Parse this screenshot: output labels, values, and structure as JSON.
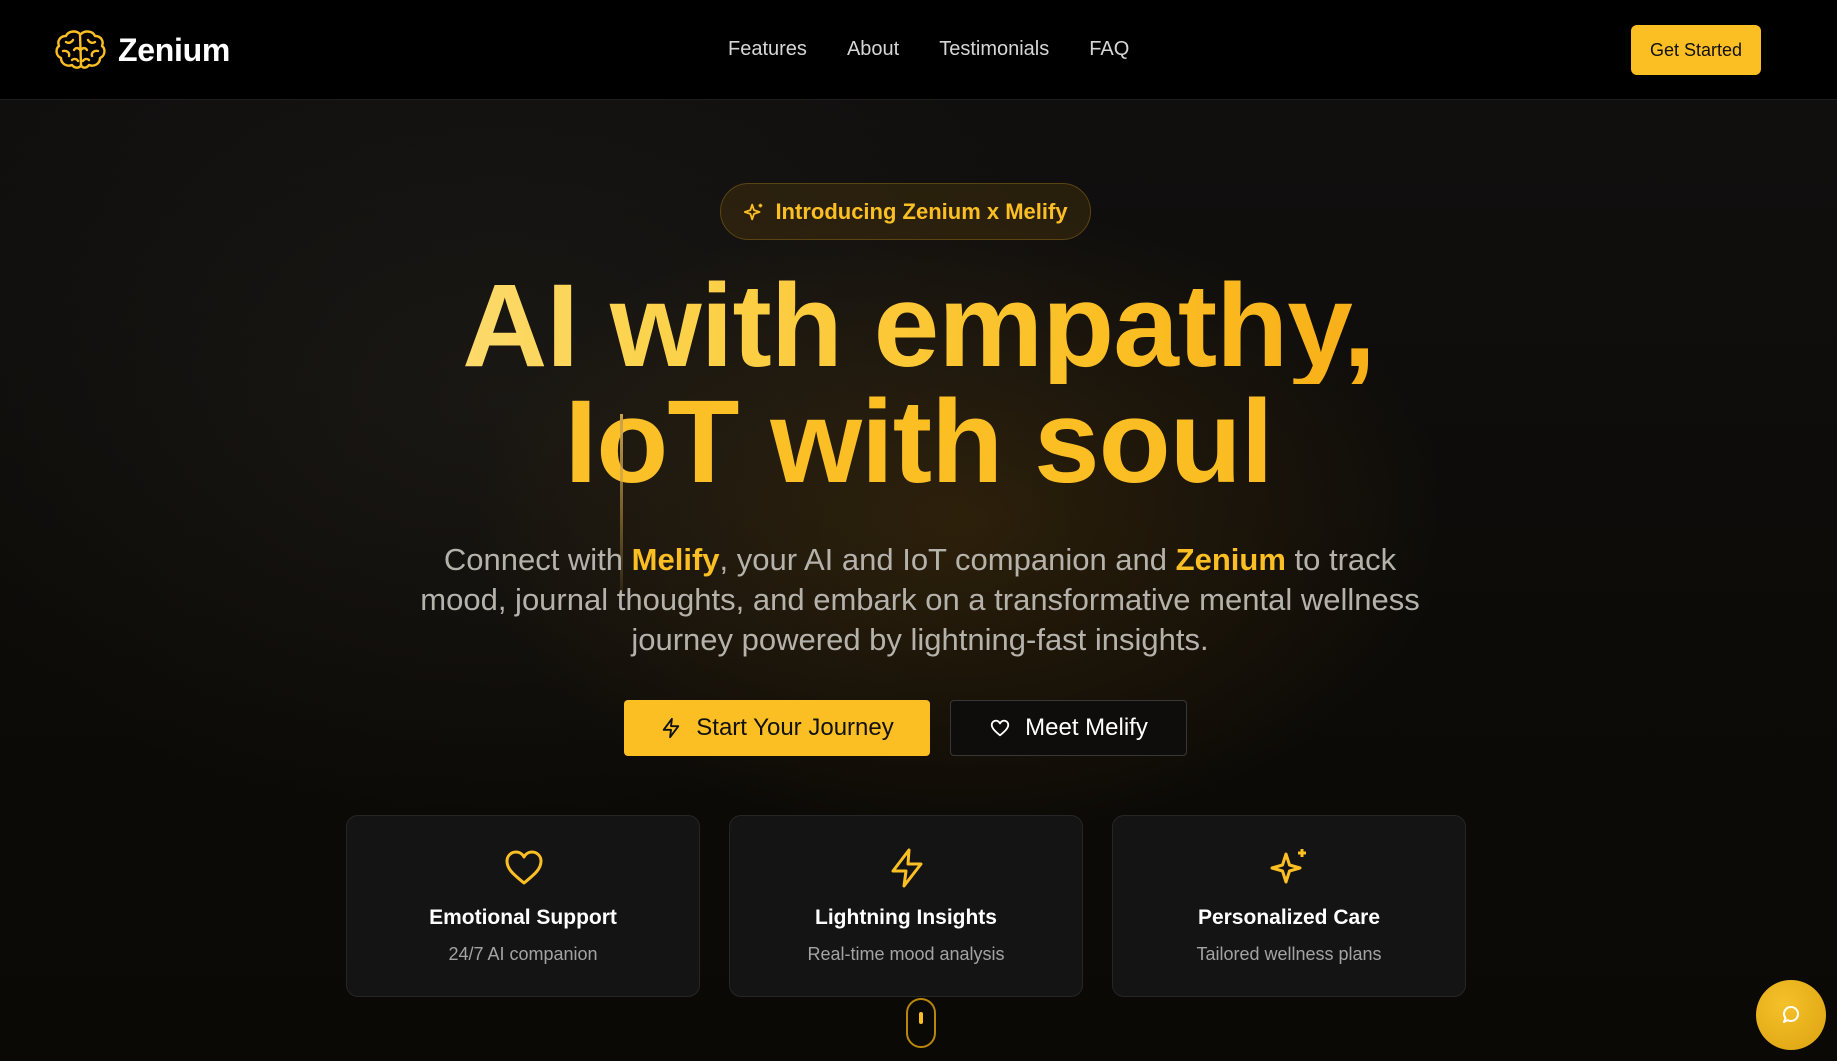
{
  "brand": {
    "name": "Zenium"
  },
  "nav": {
    "items": [
      "Features",
      "About",
      "Testimonials",
      "FAQ"
    ],
    "cta": "Get Started"
  },
  "hero": {
    "badge": "Introducing Zenium x Melify",
    "title_line1": "AI with empathy,",
    "title_line2": "IoT with soul",
    "subtitle": {
      "part1": "Connect with ",
      "highlight1": "Melify",
      "part2": ", your AI and IoT companion and ",
      "highlight2": "Zenium",
      "part3": " to track mood, journal thoughts, and embark on a transformative mental wellness journey powered by lightning-fast insights."
    },
    "primary_button": "Start Your Journey",
    "secondary_button": "Meet Melify"
  },
  "features": [
    {
      "icon": "heart-icon",
      "title": "Emotional Support",
      "subtitle": "24/7 AI companion"
    },
    {
      "icon": "lightning-icon",
      "title": "Lightning Insights",
      "subtitle": "Real-time mood analysis"
    },
    {
      "icon": "sparkles-icon",
      "title": "Personalized Care",
      "subtitle": "Tailored wellness plans"
    }
  ],
  "colors": {
    "accent": "#fbbf24",
    "background": "#0b0a09",
    "header": "#000000"
  }
}
